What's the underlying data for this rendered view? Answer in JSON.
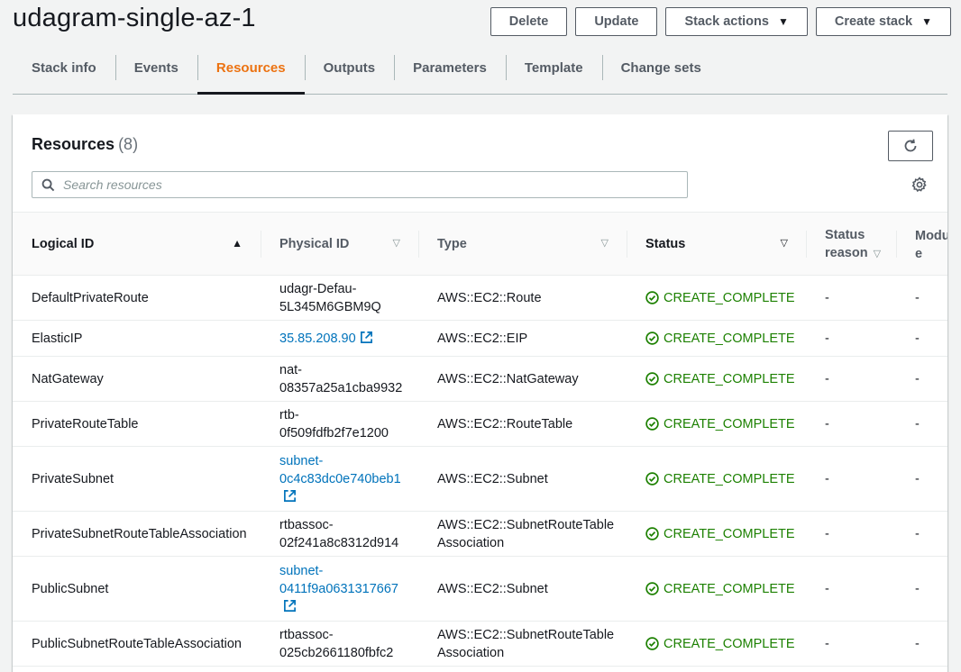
{
  "stack": {
    "name": "udagram-single-az-1"
  },
  "actions": {
    "delete": "Delete",
    "update": "Update",
    "stack_actions": "Stack actions",
    "create_stack": "Create stack"
  },
  "tabs": [
    {
      "label": "Stack info"
    },
    {
      "label": "Events"
    },
    {
      "label": "Resources",
      "active": true
    },
    {
      "label": "Outputs"
    },
    {
      "label": "Parameters"
    },
    {
      "label": "Template"
    },
    {
      "label": "Change sets"
    }
  ],
  "resources": {
    "title": "Resources",
    "count": "(8)",
    "search_placeholder": "Search resources",
    "columns": {
      "logical_id": "Logical ID",
      "physical_id": "Physical ID",
      "type": "Type",
      "status": "Status",
      "status_reason_1": "Status",
      "status_reason_2": "reason",
      "module_1": "Modul",
      "module_2": "e"
    },
    "rows": [
      {
        "logical_id": "DefaultPrivateRoute",
        "physical_1": "udagr-Defau-",
        "physical_2": "5L345M6GBM9Q",
        "type_1": "AWS::EC2::Route",
        "status": "CREATE_COMPLETE",
        "reason": "-",
        "module": "-"
      },
      {
        "logical_id": "ElasticIP",
        "physical_1": "35.85.208.90",
        "type_1": "AWS::EC2::EIP",
        "status": "CREATE_COMPLETE",
        "reason": "-",
        "module": "-"
      },
      {
        "logical_id": "NatGateway",
        "physical_1": "nat-",
        "physical_2": "08357a25a1cba9932",
        "type_1": "AWS::EC2::NatGateway",
        "status": "CREATE_COMPLETE",
        "reason": "-",
        "module": "-"
      },
      {
        "logical_id": "PrivateRouteTable",
        "physical_1": "rtb-",
        "physical_2": "0f509fdfb2f7e1200",
        "type_1": "AWS::EC2::RouteTable",
        "status": "CREATE_COMPLETE",
        "reason": "-",
        "module": "-"
      },
      {
        "logical_id": "PrivateSubnet",
        "physical_1": "subnet-",
        "physical_2": "0c4c83dc0e740beb1",
        "type_1": "AWS::EC2::Subnet",
        "status": "CREATE_COMPLETE",
        "reason": "-",
        "module": "-"
      },
      {
        "logical_id": "PrivateSubnetRouteTableAssociation",
        "physical_1": "rtbassoc-",
        "physical_2": "02f241a8c8312d914",
        "type_1": "AWS::EC2::SubnetRouteTable",
        "type_2": "Association",
        "status": "CREATE_COMPLETE",
        "reason": "-",
        "module": "-"
      },
      {
        "logical_id": "PublicSubnet",
        "physical_1": "subnet-",
        "physical_2": "0411f9a0631317667",
        "type_1": "AWS::EC2::Subnet",
        "status": "CREATE_COMPLETE",
        "reason": "-",
        "module": "-"
      },
      {
        "logical_id": "PublicSubnetRouteTableAssociation",
        "physical_1": "rtbassoc-",
        "physical_2": "025cb2661180fbfc2",
        "type_1": "AWS::EC2::SubnetRouteTable",
        "type_2": "Association",
        "status": "CREATE_COMPLETE",
        "reason": "-",
        "module": "-"
      }
    ]
  },
  "colors": {
    "accent": "#ec7211",
    "link": "#0073bb",
    "success": "#1d8102",
    "text": "#16191f"
  },
  "icons": [
    "caret-down-icon",
    "refresh-icon",
    "search-icon",
    "settings-gear-icon",
    "external-link-icon",
    "check-circle-icon",
    "sort-ascending-icon",
    "sort-descending-icon"
  ]
}
